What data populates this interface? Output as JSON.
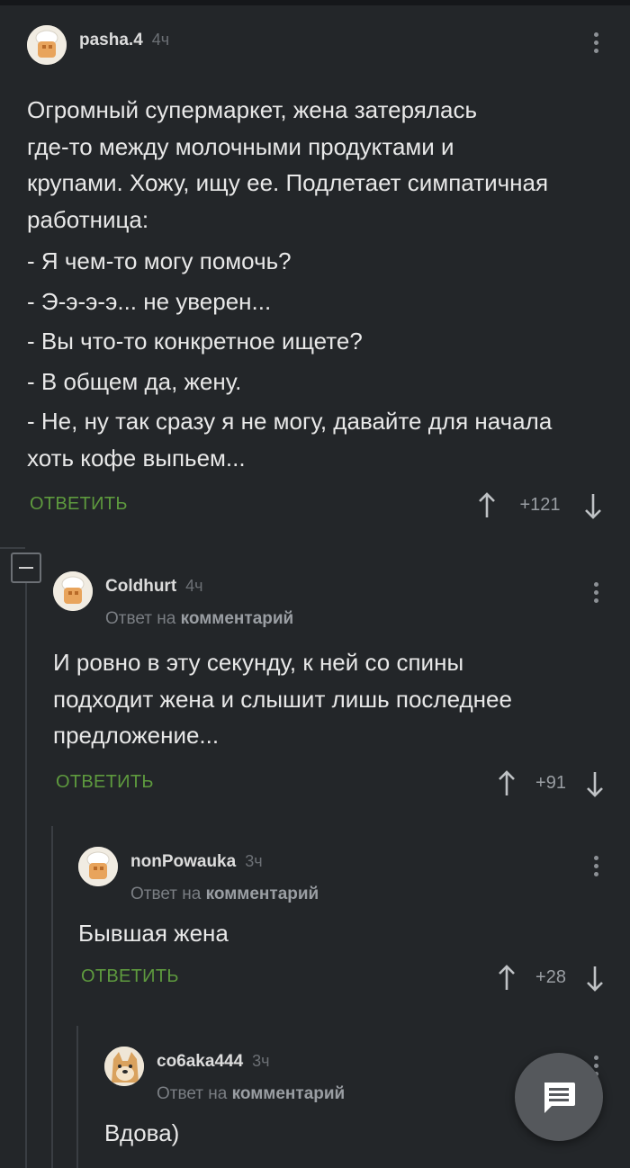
{
  "comments": [
    {
      "author": "pasha.4",
      "time": "4ч",
      "avatar": "chef-avatar",
      "body": [
        "Огромный супермаркет, жена затерялась",
        "где-то между молочными продуктами и",
        "крупами. Хожу, ищу ее. Подлетает симпатичная",
        "работница:",
        "- Я чем-то могу помочь?",
        "- Э-э-э-э... не уверен...",
        "- Вы что-то конкретное ищете?",
        "- В общем да, жену.",
        "- Не, ну так сразу я не могу, давайте для начала",
        "хоть кофе выпьем..."
      ],
      "reply_label": "ОТВЕТИТЬ",
      "score": "+121"
    },
    {
      "author": "Coldhurt",
      "time": "4ч",
      "avatar": "chef-avatar",
      "reply_prefix": "Ответ на",
      "reply_target": "комментарий",
      "body": [
        "И ровно в эту секунду, к ней со спины",
        "подходит жена и слышит лишь последнее",
        "предложение..."
      ],
      "reply_label": "ОТВЕТИТЬ",
      "score": "+91"
    },
    {
      "author": "nonPowauka",
      "time": "3ч",
      "avatar": "chef-avatar",
      "reply_prefix": "Ответ на",
      "reply_target": "комментарий",
      "body": [
        "Бывшая жена"
      ],
      "reply_label": "ОТВЕТИТЬ",
      "score": "+28"
    },
    {
      "author": "co6aka444",
      "time": "3ч",
      "avatar": "doge-avatar",
      "reply_prefix": "Ответ на",
      "reply_target": "комментарий",
      "body": [
        "Вдова)"
      ]
    }
  ],
  "icons": {
    "collapse": "minus-icon",
    "menu": "kebab-icon",
    "upvote": "arrow-up-icon",
    "downvote": "arrow-down-icon",
    "fab": "comment-icon"
  },
  "colors": {
    "background": "#232629",
    "reply_button": "#5e9a3e",
    "text": "#e8e8e8",
    "muted": "#7a7e83"
  }
}
